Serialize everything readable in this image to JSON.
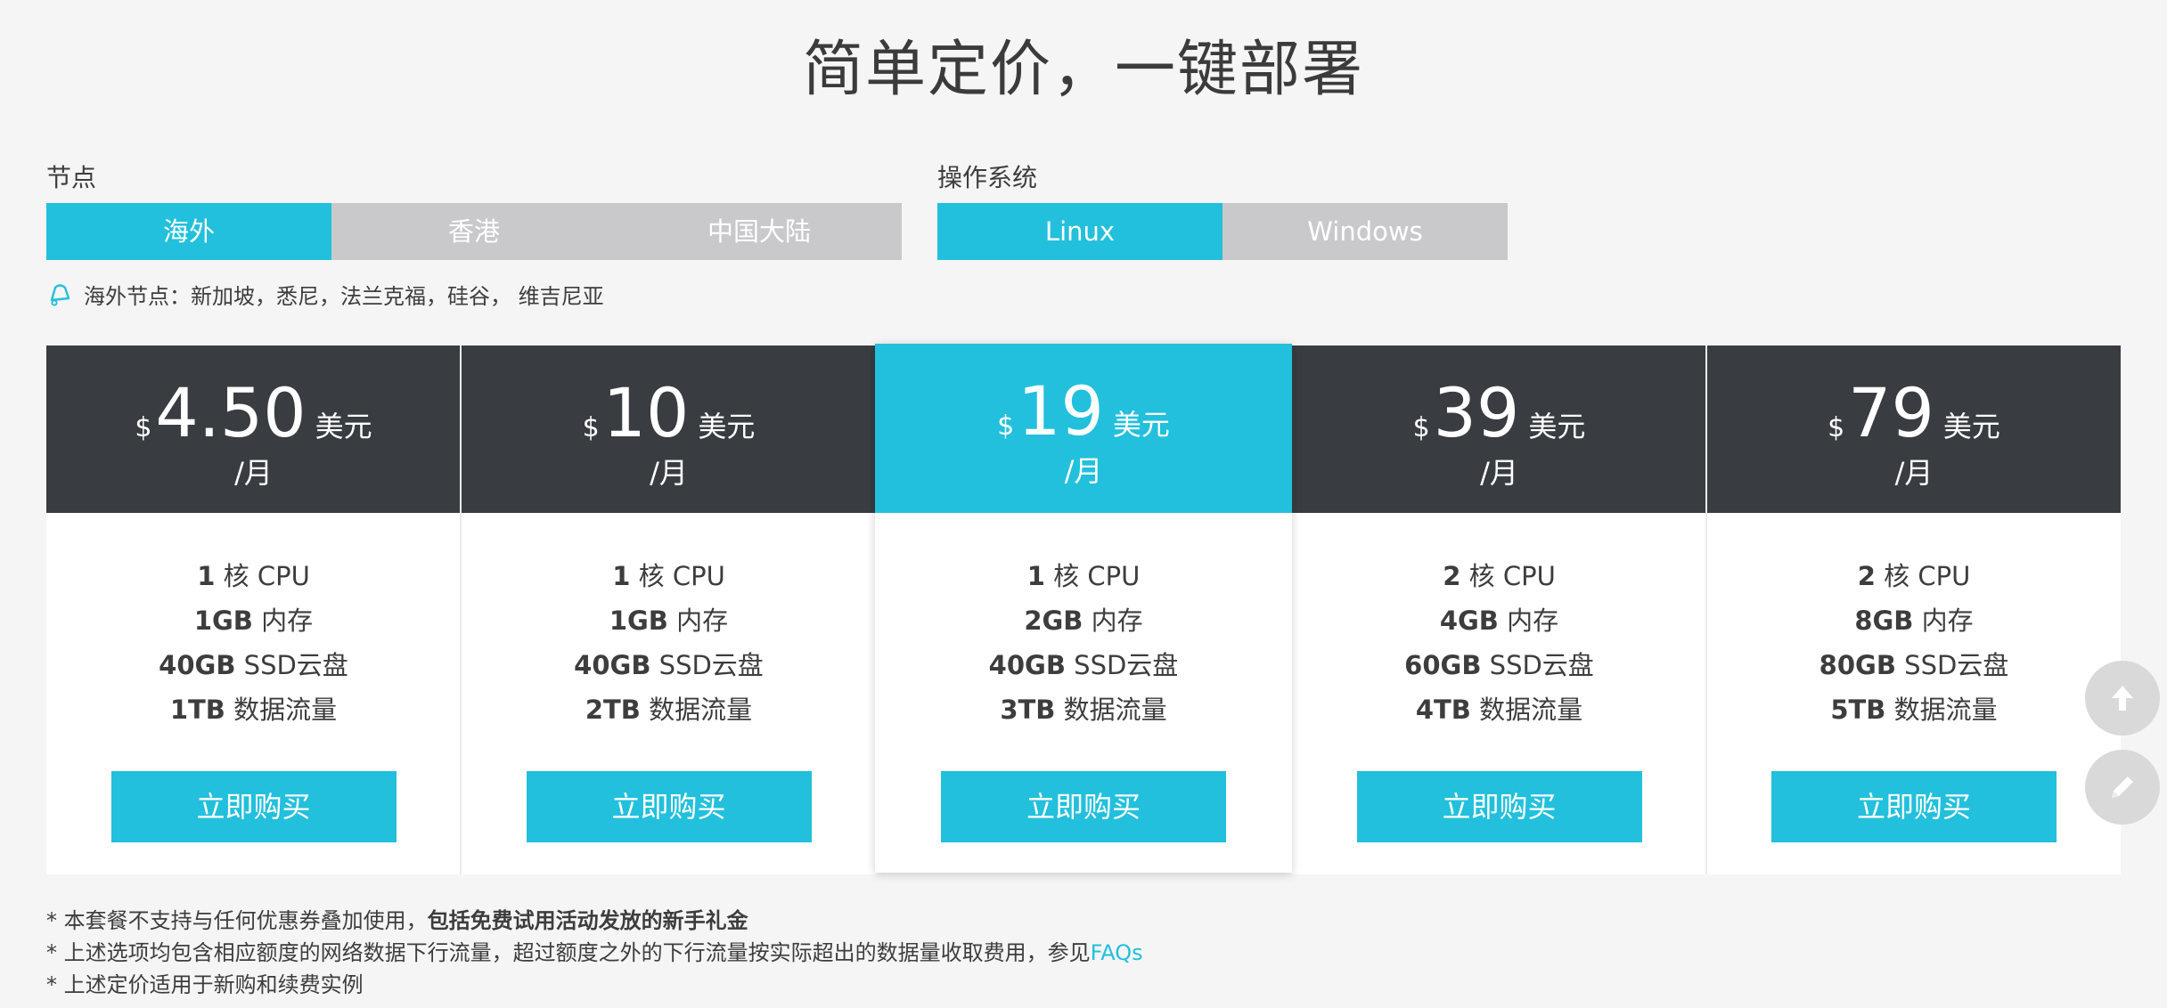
{
  "title": "简单定价，一键部署",
  "node": {
    "label": "节点",
    "options": [
      "海外",
      "香港",
      "中国大陆"
    ],
    "selected": "海外"
  },
  "os": {
    "label": "操作系统",
    "options": [
      "Linux",
      "Windows"
    ],
    "selected": "Linux"
  },
  "node_note": "海外节点：新加坡，悉尼，法兰克福，硅谷， 维吉尼亚",
  "plans": [
    {
      "currency": "$",
      "price": "4.50",
      "unit": "美元",
      "period": "/月",
      "cpu_num": "1",
      "cpu_label": "核 CPU",
      "mem_num": "1GB",
      "mem_label": "内存",
      "disk_num": "40GB",
      "disk_label": "SSD云盘",
      "traffic_num": "1TB",
      "traffic_label": "数据流量",
      "button": "立即购买"
    },
    {
      "currency": "$",
      "price": "10",
      "unit": "美元",
      "period": "/月",
      "cpu_num": "1",
      "cpu_label": "核 CPU",
      "mem_num": "1GB",
      "mem_label": "内存",
      "disk_num": "40GB",
      "disk_label": "SSD云盘",
      "traffic_num": "2TB",
      "traffic_label": "数据流量",
      "button": "立即购买"
    },
    {
      "currency": "$",
      "price": "19",
      "unit": "美元",
      "period": "/月",
      "cpu_num": "1",
      "cpu_label": "核 CPU",
      "mem_num": "2GB",
      "mem_label": "内存",
      "disk_num": "40GB",
      "disk_label": "SSD云盘",
      "traffic_num": "3TB",
      "traffic_label": "数据流量",
      "button": "立即购买"
    },
    {
      "currency": "$",
      "price": "39",
      "unit": "美元",
      "period": "/月",
      "cpu_num": "2",
      "cpu_label": "核 CPU",
      "mem_num": "4GB",
      "mem_label": "内存",
      "disk_num": "60GB",
      "disk_label": "SSD云盘",
      "traffic_num": "4TB",
      "traffic_label": "数据流量",
      "button": "立即购买"
    },
    {
      "currency": "$",
      "price": "79",
      "unit": "美元",
      "period": "/月",
      "cpu_num": "2",
      "cpu_label": "核 CPU",
      "mem_num": "8GB",
      "mem_label": "内存",
      "disk_num": "80GB",
      "disk_label": "SSD云盘",
      "traffic_num": "5TB",
      "traffic_label": "数据流量",
      "button": "立即购买"
    }
  ],
  "footnotes": {
    "line1_prefix": "* 本套餐不支持与任何优惠券叠加使用，",
    "line1_bold": "包括免费试用活动发放的新手礼金",
    "line2_prefix": "* 上述选项均包含相应额度的网络数据下行流量，超过额度之外的下行流量按实际超出的数据量收取费用，参见",
    "line2_link": "FAQs",
    "line3": "* 上述定价适用于新购和续费实例"
  },
  "icons": {
    "note": "bell-icon",
    "scroll_top": "arrow-up-icon",
    "feedback": "pencil-icon"
  },
  "colors": {
    "accent": "#22c0dc",
    "dark_header": "#393d42",
    "inactive_option": "#c9c9cb"
  }
}
